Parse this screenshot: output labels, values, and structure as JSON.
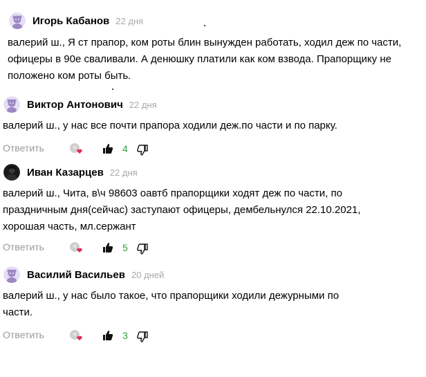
{
  "comments": [
    {
      "author": "Игорь Кабанов",
      "time": "22 дня",
      "text": "валерий ш., Я ст прапор, ком роты блин вынужден работать, ходил деж по части, офицеры в 90е сваливали. А денюшку платили как ком взвода. Прапорщику не положено ком роты быть."
    },
    {
      "author": "Виктор Антонович",
      "time": "22 дня",
      "text": "валерий ш., у нас все почти прапора ходили деж.по части и по парку.",
      "reply_label": "Ответить",
      "likes": "4"
    },
    {
      "author": "Иван Казарцев",
      "time": "22 дня",
      "text": "валерий ш., Чита, в\\ч 98603 оавтб прапорщики ходят деж по части, по праздничным дня(сейчас) заступают офицеры, дембельнулся 22.10.2021, хорошая часть, мл.сержант",
      "reply_label": "Ответить",
      "likes": "5"
    },
    {
      "author": "Василий Васильев",
      "time": "20 дней",
      "text": "валерий ш., у нас было такое, что прапорщики ходили дежурными по части.",
      "reply_label": "Ответить",
      "likes": "3"
    }
  ],
  "colors": {
    "likes_count": "#2ea043",
    "muted": "#9a9a9a",
    "avatar_bg": "#e6def5",
    "avatar_fg": "#8d7ab6",
    "heart": "#e4264b"
  },
  "icons": {
    "like": "thumb-up-icon",
    "dislike": "thumb-down-icon",
    "reactions": "reactions-icon",
    "avatar_default": "default-avatar-icon"
  }
}
